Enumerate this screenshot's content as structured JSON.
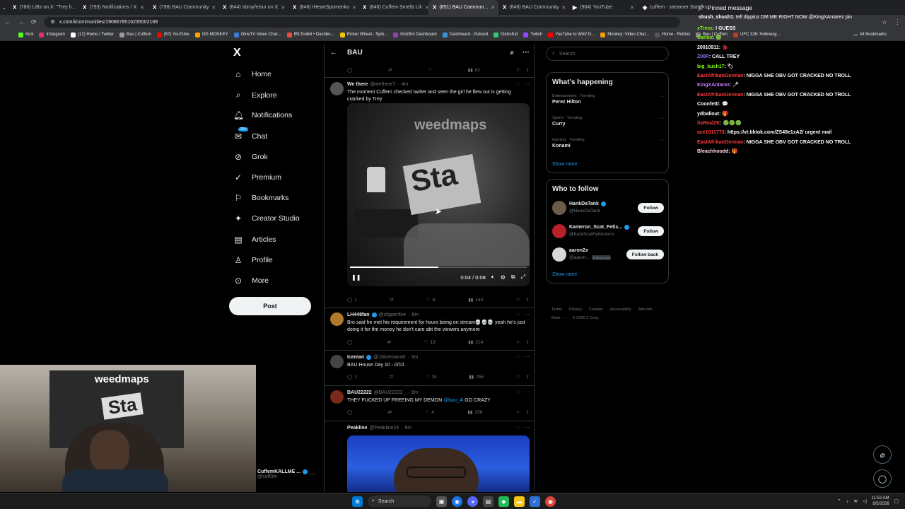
{
  "browser": {
    "tabs": [
      {
        "icon": "X",
        "label": "(780) LiBz on X: \"Trey h..."
      },
      {
        "icon": "X",
        "label": "(793) Notifications / X"
      },
      {
        "icon": "X",
        "label": "(798) BAU Community"
      },
      {
        "icon": "X",
        "label": "(844) sbroyfeisur on X"
      },
      {
        "icon": "X",
        "label": "(846) IHeartSpomenko"
      },
      {
        "icon": "X",
        "label": "(846) Cuffem Smells Lik"
      },
      {
        "icon": "X",
        "label": "(851) BAU Commun..."
      },
      {
        "icon": "X",
        "label": "(848) BAU Community"
      },
      {
        "icon": "▶",
        "label": "(964) YouTube"
      },
      {
        "icon": "◆",
        "label": "cuffem - streamer Stats"
      }
    ],
    "url": "x.com/i/communities/1908678516235002169",
    "bookmarks": [
      "Kick",
      "Instagram",
      "(12) Home / Twitter",
      "Bau | Cuffem",
      "(57) YouTube",
      "OG MONKEY",
      "OmeTV Video Chat...",
      "IRLToolkit • Dashbo...",
      "Picker Wheel - Spin...",
      "KickBot Dashboard",
      "Dashboard - Pulsoid",
      "DistroKid",
      "Twitch",
      "YouTube to WAV D...",
      "Monkey: Video Chat...",
      "Home - Roblox",
      "Bau | Cuffem",
      "UFC 326: Holloway..."
    ],
    "all_bookmarks": "All Bookmarks"
  },
  "nav": {
    "logo": "X",
    "items": [
      "Home",
      "Explore",
      "Notifications",
      "Chat",
      "Grok",
      "Premium",
      "Bookmarks",
      "Creator Studio",
      "Articles",
      "Profile",
      "More"
    ],
    "chat_badge": "20+",
    "post_label": "Post"
  },
  "feed": {
    "title": "BAU",
    "top_actions": {
      "views": "82"
    },
    "tweets": [
      {
        "name": "We there",
        "handle": "@wethere7",
        "time": "4m",
        "text": "The moment Cuffem checked twitter and seen the girl he flew out is getting cracked by Trey",
        "video": {
          "watermark": "weedmaps",
          "sign": "Sta",
          "time": "0:04 / 0:08",
          "progress": 0.5
        },
        "replies": "1",
        "likes": "6",
        "views": "140"
      },
      {
        "name": "LH448fan",
        "handle": "@clipperfive",
        "time": "8m",
        "text": "Bro said he met his requirement for hours being on stream💀💀💀 yeah he's just doing it for the money he don't care abt the viewers anymore",
        "replies": "",
        "likes": "13",
        "views": "214"
      },
      {
        "name": "Iceman",
        "handle": "@10iceman40",
        "time": "9m",
        "text": "BAU House Day 10 - 0/10",
        "replies": "1",
        "likes": "10",
        "views": "255"
      },
      {
        "name": "BAU22222",
        "handle": "@BAU22222_",
        "time": "9m",
        "text_before": "THEY FUCKED UP FREEING MY DEMON ",
        "mention": "@bau_4l",
        "text_after": " GO CRAZY",
        "replies": "",
        "likes": "4",
        "views": "258"
      },
      {
        "name": "Peakline",
        "handle": "@Peakline24",
        "time": "9m"
      }
    ]
  },
  "sidebar": {
    "search_placeholder": "Search",
    "happening_title": "What’s happening",
    "trends": [
      {
        "category": "Entertainment · Trending",
        "name": "Perez Hilton"
      },
      {
        "category": "Sports · Trending",
        "name": "Curry"
      },
      {
        "category": "Gaming · Trending",
        "name": "Konami"
      }
    ],
    "show_more": "Show more",
    "follow_title": "Who to follow",
    "follow": [
      {
        "name": "HankDaTank",
        "handle": "@HankDaTank",
        "button": "Follow",
        "verified": true,
        "follows_you": ""
      },
      {
        "name": "Kameron_Scat_Fetis...",
        "handle": "@KamScatFetishAmo",
        "button": "Follow",
        "verified": true,
        "follows_you": ""
      },
      {
        "name": "aaron2x",
        "handle": "@aaron...",
        "button": "Follow back",
        "verified": false,
        "follows_you": "Follows you"
      }
    ],
    "follow_show_more": "Show more",
    "footer": [
      "Terms",
      "Privacy",
      "Cookies",
      "Accessibility",
      "Ads info",
      "More ···",
      "© 2026 X Corp."
    ]
  },
  "chat": {
    "pinned_label": "Pinned message",
    "pinned_user": "shush_shush1",
    "pinned_text": ": tell dippinz DM ME RIGHT NOW @KingXAntarez pin",
    "lines": [
      {
        "user": "xTreez",
        "color": "#7cfc00",
        "text": ": I GUESS"
      },
      {
        "user": "Carlos",
        "color": "#7cfc00",
        "text": ": 🟢"
      },
      {
        "user": "20010911",
        "color": "#ffffff",
        "text": ": 🐞"
      },
      {
        "user": "Z00P",
        "color": "#8a7cff",
        "text": ": CALL TREY"
      },
      {
        "user": "big_kush17",
        "color": "#7cfc00",
        "text": ": 🏷"
      },
      {
        "user": "EastAfrikanGerman",
        "color": "#ff3b3b",
        "text": ": NIGGA SHE OBV GOT CRACKED NO TROLL"
      },
      {
        "user": "KingXAntarez",
        "color": "#c77dff",
        "text": ": 🎤"
      },
      {
        "user": "EastAfrikanGerman",
        "color": "#ff3b3b",
        "text": ": NIGGA SHE OBV GOT CRACKED NO TROLL"
      },
      {
        "user": "Coonfetti",
        "color": "#ffffff",
        "text": ": 💬"
      },
      {
        "user": "ydballout",
        "color": "#ffffff",
        "text": ": 🎁"
      },
      {
        "user": "itsRealZK",
        "color": "#ff3b3b",
        "text": ": 🟢🟢🟢"
      },
      {
        "user": "ace1011773",
        "color": "#ff3b3b",
        "text": ": https://vt.tiktok.com/ZS49e1xA2/ urgent mail"
      },
      {
        "user": "EastAfrikanGerman",
        "color": "#ff3b3b",
        "text": ": NIGGA SHE OBV GOT CRACKED NO TROLL"
      },
      {
        "user": "Bleachhoodd",
        "color": "#ffd6e0",
        "text": ": 🎁"
      }
    ]
  },
  "webcam": {
    "banner": "weedmaps",
    "sign": "Sta"
  },
  "profile": {
    "name": "CuffemKALLME ...",
    "handle": "@cuff3m"
  },
  "taskbar": {
    "search": "Search",
    "time": "11:52 AM",
    "date": "8/5/2026"
  }
}
